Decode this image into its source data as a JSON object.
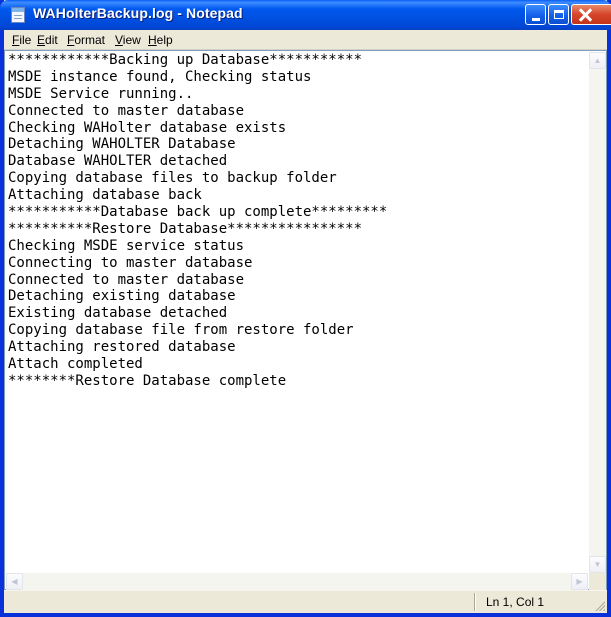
{
  "window": {
    "title": "WAHolterBackup.log - Notepad",
    "accent": "#0a5ff5",
    "close_color": "#d6452a"
  },
  "menu": {
    "file": "File",
    "edit": "Edit",
    "format": "Format",
    "view": "View",
    "help": "Help"
  },
  "editor": {
    "lines": [
      "************Backing up Database***********",
      "MSDE instance found, Checking status",
      "MSDE Service running..",
      "Connected to master database",
      "Checking WAHolter database exists",
      "Detaching WAHOLTER Database",
      "Database WAHOLTER detached",
      "Copying database files to backup folder",
      "Attaching database back",
      "***********Database back up complete*********",
      "**********Restore Database****************",
      "Checking MSDE service status",
      "Connecting to master database",
      "Connected to master database",
      "Detaching existing database",
      "Existing database detached",
      "Copying database file from restore folder",
      "Attaching restored database",
      "Attach completed",
      "********Restore Database complete"
    ]
  },
  "statusbar": {
    "position": "Ln 1, Col 1"
  },
  "icons": {
    "app": "notepad-icon",
    "minimize": "minimize-icon",
    "maximize": "maximize-icon",
    "close": "close-icon"
  }
}
